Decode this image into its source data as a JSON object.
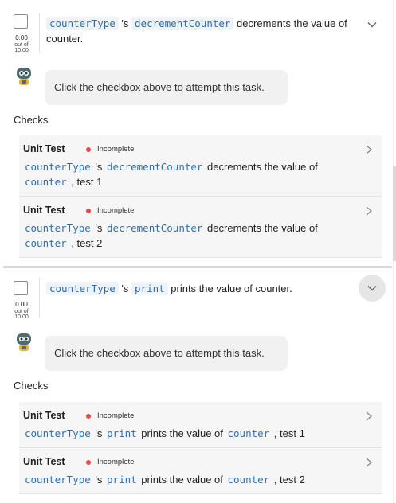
{
  "tasks": [
    {
      "title": {
        "class_name": "counterType",
        "possessive": " 's ",
        "method": "decrementCounter",
        "rest": " decrements the value of counter."
      },
      "score": {
        "value": "0.00",
        "out_of": "out of",
        "max": "10.00"
      },
      "prompt": "Click the checkbox above to attempt this task.",
      "checks_label": "Checks",
      "checks": [
        {
          "name": "Unit Test",
          "status": "Incomplete",
          "class_name": "counterType",
          "possessive": " 's ",
          "method": "decrementCounter",
          "middle": " decrements the value of ",
          "target": "counter",
          "suffix": " , test 1"
        },
        {
          "name": "Unit Test",
          "status": "Incomplete",
          "class_name": "counterType",
          "possessive": " 's ",
          "method": "decrementCounter",
          "middle": " decrements the value of ",
          "target": "counter",
          "suffix": " , test 2"
        }
      ]
    },
    {
      "title": {
        "class_name": "counterType",
        "possessive": " 's ",
        "method": "print",
        "rest": " prints the value of counter."
      },
      "score": {
        "value": "0.00",
        "out_of": "out of",
        "max": "10.00"
      },
      "prompt": "Click the checkbox above to attempt this task.",
      "checks_label": "Checks",
      "checks": [
        {
          "name": "Unit Test",
          "status": "Incomplete",
          "class_name": "counterType",
          "possessive": " 's ",
          "method": "print",
          "middle": " prints the value of ",
          "target": "counter",
          "suffix": " , test 1"
        },
        {
          "name": "Unit Test",
          "status": "Incomplete",
          "class_name": "counterType",
          "possessive": " 's ",
          "method": "print",
          "middle": " prints the value of ",
          "target": "counter",
          "suffix": " , test 2"
        }
      ]
    }
  ],
  "colors": {
    "code": "#2f6fb0",
    "incomplete_dot": "#e24a4a",
    "bubble": "#f1f1f1",
    "check_bg": "#f6f6f6"
  },
  "icons": {
    "expand": "chevron-down-icon",
    "open_check": "chevron-right-icon",
    "avatar": "robot-icon"
  }
}
